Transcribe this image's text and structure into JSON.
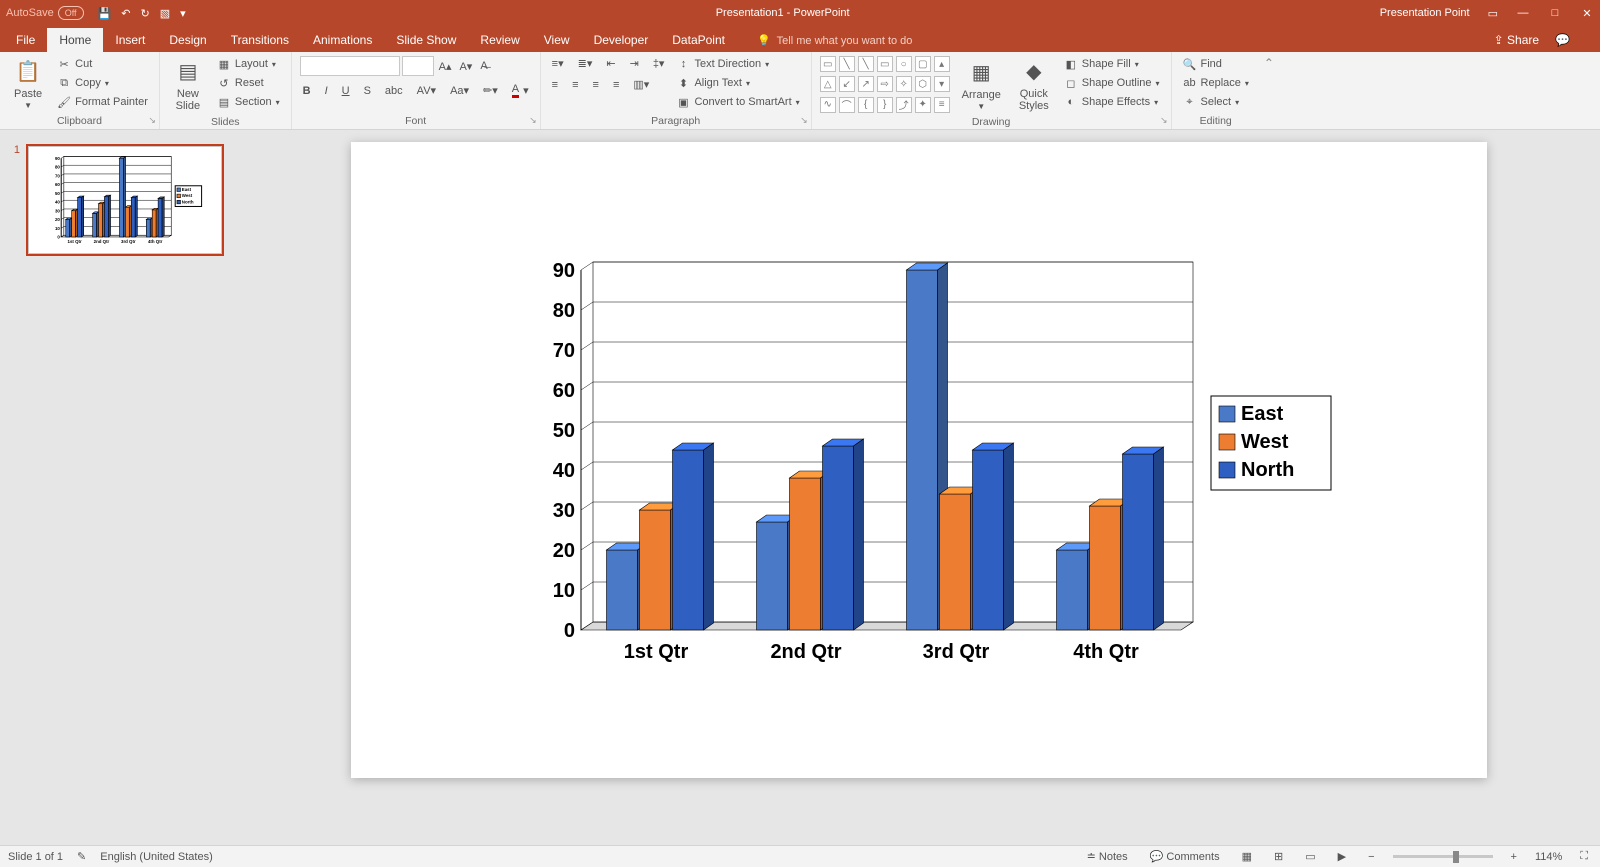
{
  "titlebar": {
    "autosave_label": "AutoSave",
    "autosave_state": "Off",
    "doc_title": "Presentation1 - PowerPoint",
    "presentation_point": "Presentation Point"
  },
  "tabs": {
    "file": "File",
    "home": "Home",
    "insert": "Insert",
    "design": "Design",
    "transitions": "Transitions",
    "animations": "Animations",
    "slideshow": "Slide Show",
    "review": "Review",
    "view": "View",
    "developer": "Developer",
    "datapoint": "DataPoint",
    "tellme": "Tell me what you want to do",
    "share": "Share"
  },
  "ribbon": {
    "clipboard": {
      "paste": "Paste",
      "cut": "Cut",
      "copy": "Copy",
      "fmtpainter": "Format Painter",
      "label": "Clipboard"
    },
    "slides": {
      "newslide": "New\nSlide",
      "layout": "Layout",
      "reset": "Reset",
      "section": "Section",
      "label": "Slides"
    },
    "font": {
      "label": "Font"
    },
    "paragraph": {
      "textdir": "Text Direction",
      "align": "Align Text",
      "smartart": "Convert to SmartArt",
      "label": "Paragraph"
    },
    "drawing": {
      "arrange": "Arrange",
      "quickstyles": "Quick\nStyles",
      "shapefill": "Shape Fill",
      "shapeoutline": "Shape Outline",
      "shapeeffects": "Shape Effects",
      "label": "Drawing"
    },
    "editing": {
      "find": "Find",
      "replace": "Replace",
      "select": "Select",
      "label": "Editing"
    }
  },
  "thumb": {
    "index": "1"
  },
  "status": {
    "slidecount": "Slide 1 of 1",
    "language": "English (United States)",
    "notes": "Notes",
    "comments": "Comments",
    "zoom": "114%"
  },
  "chart_data": {
    "type": "bar",
    "categories": [
      "1st Qtr",
      "2nd Qtr",
      "3rd Qtr",
      "4th Qtr"
    ],
    "series": [
      {
        "name": "East",
        "color": "#4a7ac7",
        "values": [
          20,
          27,
          90,
          20
        ]
      },
      {
        "name": "West",
        "color": "#ed7d31",
        "values": [
          30,
          38,
          34,
          31
        ]
      },
      {
        "name": "North",
        "color": "#2f5fc1",
        "values": [
          45,
          46,
          45,
          44
        ]
      }
    ],
    "ylim": [
      0,
      90
    ],
    "yticks": [
      0,
      10,
      20,
      30,
      40,
      50,
      60,
      70,
      80,
      90
    ],
    "title": "",
    "xlabel": "",
    "ylabel": ""
  }
}
